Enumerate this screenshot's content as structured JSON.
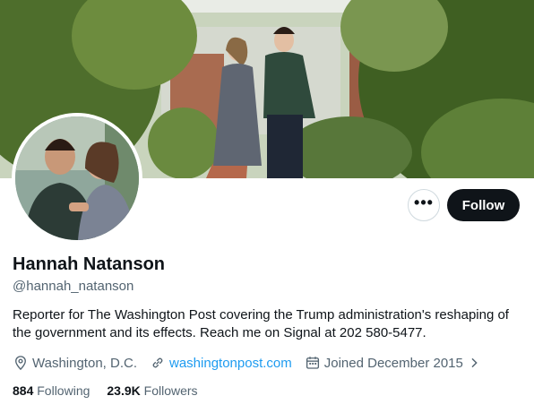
{
  "profile": {
    "name": "Hannah Natanson",
    "handle": "@hannah_natanson",
    "bio": "Reporter for The Washington Post covering the Trump administration's reshaping of the government and its effects. Reach me on Signal at 202 580-5477.",
    "location": "Washington, D.C.",
    "website": "washingtonpost.com",
    "joined": "Joined December 2015",
    "following_count": "884",
    "following_label": "Following",
    "followers_count": "23.9K",
    "followers_label": "Followers"
  },
  "actions": {
    "more_label": "•••",
    "follow_label": "Follow"
  },
  "icons": {
    "location": "location-pin-icon",
    "website": "link-icon",
    "joined": "calendar-icon",
    "joined_expand": "chevron-right-icon"
  },
  "colors": {
    "text_primary": "#0f1419",
    "text_secondary": "#536471",
    "link": "#1d9bf0",
    "follow_bg": "#0f1419"
  }
}
